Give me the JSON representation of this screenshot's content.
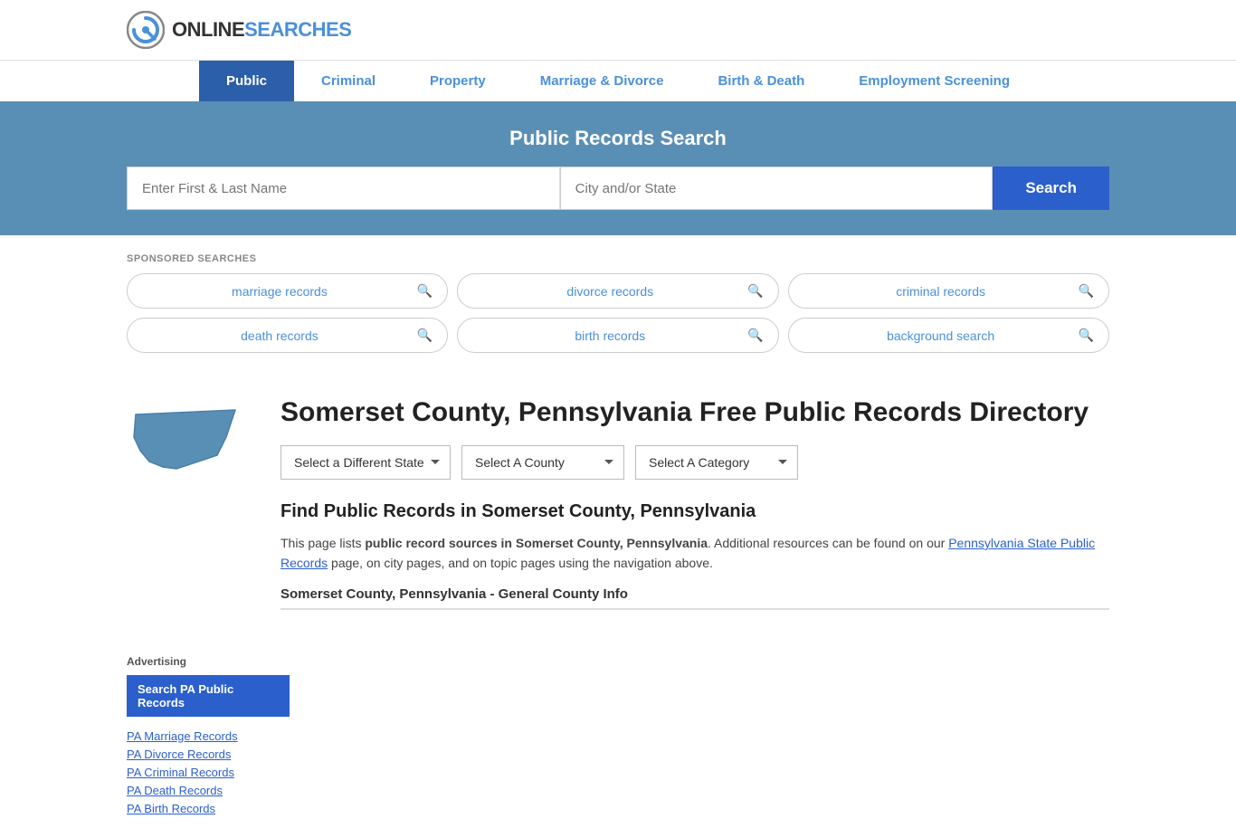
{
  "logo": {
    "text_online": "ONLINE",
    "text_searches": "SEARCHES"
  },
  "nav": {
    "items": [
      {
        "label": "Public",
        "active": true
      },
      {
        "label": "Criminal",
        "active": false
      },
      {
        "label": "Property",
        "active": false
      },
      {
        "label": "Marriage & Divorce",
        "active": false
      },
      {
        "label": "Birth & Death",
        "active": false
      },
      {
        "label": "Employment Screening",
        "active": false
      }
    ]
  },
  "search_banner": {
    "title": "Public Records Search",
    "name_placeholder": "Enter First & Last Name",
    "location_placeholder": "City and/or State",
    "search_button": "Search"
  },
  "sponsored": {
    "label": "SPONSORED SEARCHES",
    "items": [
      {
        "text": "marriage records"
      },
      {
        "text": "divorce records"
      },
      {
        "text": "criminal records"
      },
      {
        "text": "death records"
      },
      {
        "text": "birth records"
      },
      {
        "text": "background search"
      }
    ]
  },
  "county": {
    "title": "Somerset County, Pennsylvania Free Public Records Directory",
    "dropdowns": {
      "state": "Select a Different State",
      "county": "Select A County",
      "category": "Select A Category"
    },
    "find_title": "Find Public Records in Somerset County, Pennsylvania",
    "desc_part1": "This page lists ",
    "desc_bold": "public record sources in Somerset County, Pennsylvania",
    "desc_part2": ". Additional resources can be found on our ",
    "desc_link": "Pennsylvania State Public Records",
    "desc_part3": " page, on city pages, and on topic pages using the navigation above.",
    "general_info": "Somerset County, Pennsylvania - General County Info"
  },
  "sidebar": {
    "ad_label": "Advertising",
    "ad_button": "Search PA Public Records",
    "links": [
      {
        "text": "PA Marriage Records"
      },
      {
        "text": "PA Divorce Records"
      },
      {
        "text": "PA Criminal Records"
      },
      {
        "text": "PA Death Records"
      },
      {
        "text": "PA Birth Records"
      }
    ]
  }
}
